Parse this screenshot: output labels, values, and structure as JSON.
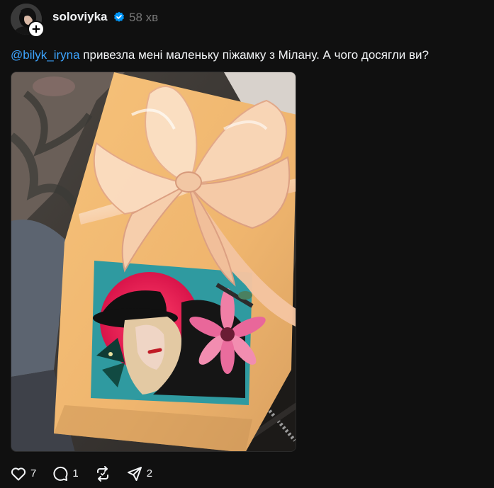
{
  "post": {
    "author": {
      "username": "soloviyka",
      "verified": true,
      "timestamp": "58 хв",
      "avatar_icon": "avatar-photo",
      "follow_icon": "plus-icon"
    },
    "caption": {
      "mention": "@bilyk_iryna",
      "text": " привезла мені маленьку піжамку з Мілану. А чого досягли ви?"
    },
    "image_description_icon": "gift-box-photo",
    "actions": {
      "like": {
        "icon": "heart-icon",
        "count": "7"
      },
      "comment": {
        "icon": "comment-icon",
        "count": "1"
      },
      "repost": {
        "icon": "repost-icon"
      },
      "share": {
        "icon": "share-icon",
        "count": "2"
      }
    },
    "colors": {
      "background": "#101010",
      "mention": "#3da5ff",
      "verified": "#0095f6",
      "muted": "#777777"
    }
  }
}
